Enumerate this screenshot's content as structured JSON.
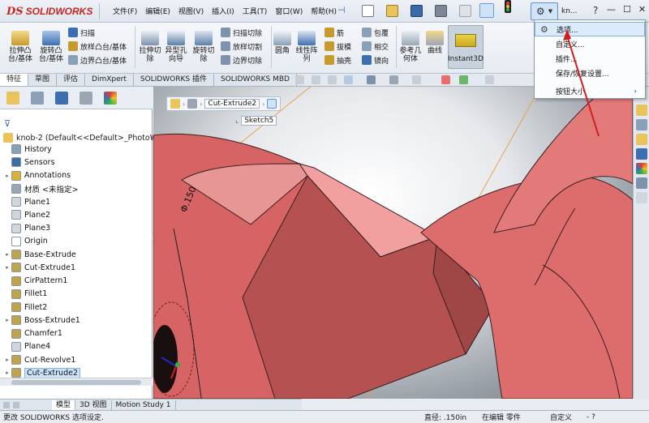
{
  "app": {
    "logo_ds": "DS",
    "logo_text": "SOLIDWORKS"
  },
  "menu": [
    "文件(F)",
    "编辑(E)",
    "视图(V)",
    "插入(I)",
    "工具(T)",
    "窗口(W)",
    "帮助(H)"
  ],
  "titlebar": {
    "user": "kn...",
    "help": "?"
  },
  "command_manager": {
    "big_buttons": [
      {
        "label": "拉伸凸\n台/基体"
      },
      {
        "label": "旋转凸\n台/基体"
      },
      {
        "label": "拉伸切\n除"
      },
      {
        "label": "异型孔\n向导"
      },
      {
        "label": "旋转切\n除"
      },
      {
        "label": "圆角"
      },
      {
        "label": "线性阵\n列"
      },
      {
        "label": "参考几\n何体"
      },
      {
        "label": "曲线"
      }
    ],
    "small_buttons": [
      "扫描",
      "放样凸台/基体",
      "边界凸台/基体",
      "扫描切除",
      "放样切割",
      "边界切除",
      "筋",
      "拔模",
      "抽壳",
      "包覆",
      "相交",
      "镜向"
    ],
    "instant3d": "Instant3D"
  },
  "tabs": [
    {
      "label": "特征",
      "active": true
    },
    {
      "label": "草图"
    },
    {
      "label": "评估"
    },
    {
      "label": "DimXpert"
    },
    {
      "label": "SOLIDWORKS 插件"
    },
    {
      "label": "SOLIDWORKS MBD"
    }
  ],
  "feature_tree": {
    "root": "knob-2  (Default<<Default>_PhotoWo",
    "items": [
      {
        "label": "History",
        "expand": false,
        "icon": "history-icon",
        "color": "#8aa0b8"
      },
      {
        "label": "Sensors",
        "expand": false,
        "icon": "sensor-icon",
        "color": "#3a6ea5"
      },
      {
        "label": "Annotations",
        "expand": true,
        "icon": "annotation-icon",
        "color": "#d8b234"
      },
      {
        "label": "材质 <未指定>",
        "expand": false,
        "icon": "material-icon",
        "color": "#9aa6b4"
      },
      {
        "label": "Plane1",
        "expand": false,
        "icon": "plane-icon",
        "color": "#cfd6de"
      },
      {
        "label": "Plane2",
        "expand": false,
        "icon": "plane-icon",
        "color": "#cfd6de"
      },
      {
        "label": "Plane3",
        "expand": false,
        "icon": "plane-icon",
        "color": "#cfd6de"
      },
      {
        "label": "Origin",
        "expand": false,
        "icon": "origin-icon",
        "color": "#ffffff"
      },
      {
        "label": "Base-Extrude",
        "expand": true,
        "icon": "extrude-icon",
        "color": "#c2a448"
      },
      {
        "label": "Cut-Extrude1",
        "expand": true,
        "icon": "cut-extrude-icon",
        "color": "#c2a448"
      },
      {
        "label": "CirPattern1",
        "expand": false,
        "icon": "pattern-icon",
        "color": "#c2a448"
      },
      {
        "label": "Fillet1",
        "expand": false,
        "icon": "fillet-icon",
        "color": "#c2a448"
      },
      {
        "label": "Fillet2",
        "expand": false,
        "icon": "fillet-icon",
        "color": "#c2a448"
      },
      {
        "label": "Boss-Extrude1",
        "expand": true,
        "icon": "extrude-icon",
        "color": "#c2a448"
      },
      {
        "label": "Chamfer1",
        "expand": false,
        "icon": "chamfer-icon",
        "color": "#c2a448"
      },
      {
        "label": "Plane4",
        "expand": false,
        "icon": "plane-icon",
        "color": "#cfd6de"
      },
      {
        "label": "Cut-Revolve1",
        "expand": true,
        "icon": "revolve-icon",
        "color": "#c2a448"
      },
      {
        "label": "Cut-Extrude2",
        "expand": true,
        "icon": "cut-extrude-icon",
        "color": "#c2a448",
        "selected": true
      }
    ]
  },
  "viewport": {
    "breadcrumb_label": "Cut-Extrude2",
    "sketch_label": "Sketch5",
    "dimension": "Φ.150",
    "part_color": "#e06d6d"
  },
  "dropdown": {
    "items": [
      {
        "label": "选项...",
        "highlight": true
      },
      {
        "label": "自定义..."
      },
      {
        "label": "插件..."
      },
      {
        "label": "保存/恢复设置..."
      },
      {
        "label": "按钮大小",
        "submenu": true
      }
    ]
  },
  "bottom_tabs": [
    {
      "label": "模型",
      "active": true
    },
    {
      "label": "3D 视图"
    },
    {
      "label": "Motion Study 1"
    }
  ],
  "status": {
    "message": "更改 SOLIDWORKS 选项设定.",
    "diameter": "直径: .150in",
    "edit_mode": "在编辑 零件",
    "custom": "自定义",
    "extra": "- ?"
  }
}
